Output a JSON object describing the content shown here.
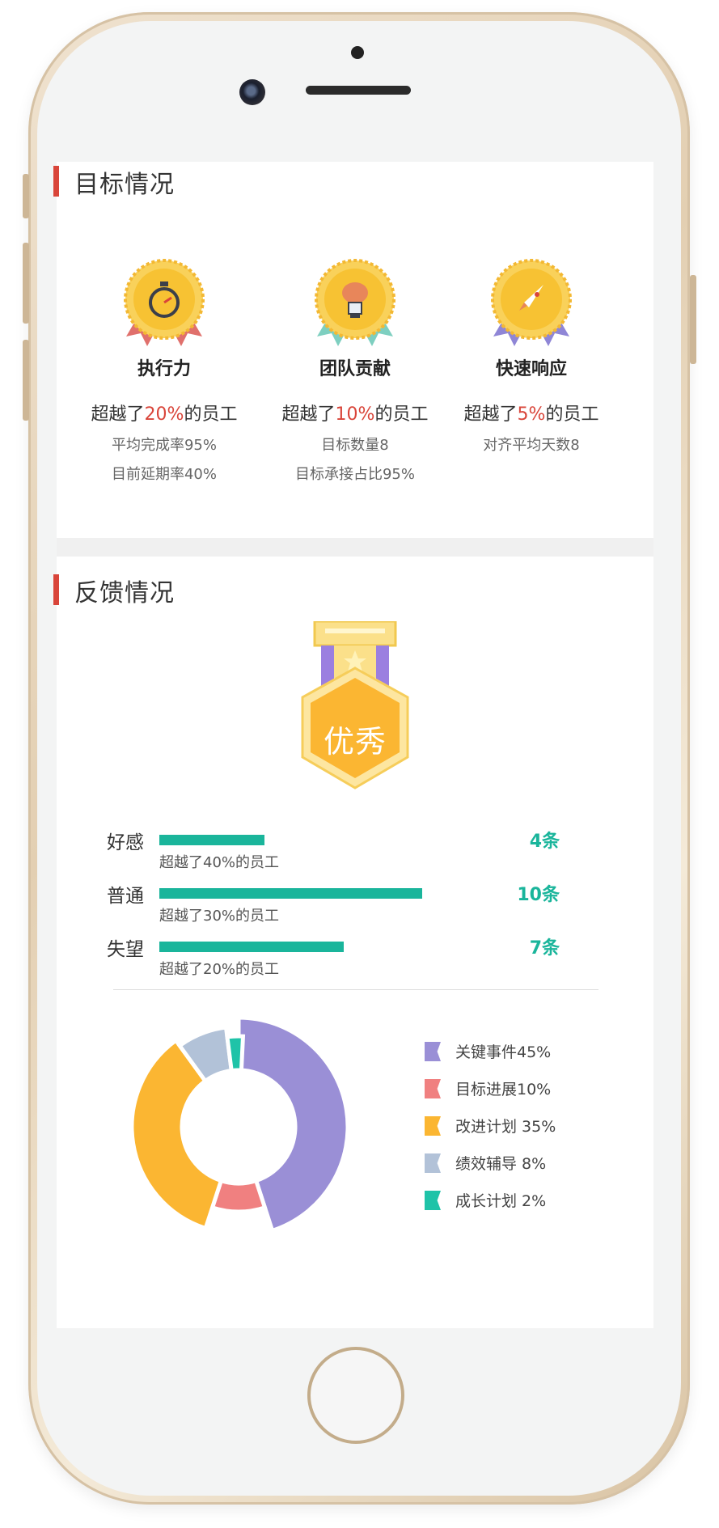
{
  "goals": {
    "title": "目标情况",
    "medals": [
      {
        "name": "执行力",
        "beyond_prefix": "超越了",
        "beyond_pct": "20%",
        "beyond_suffix": "的员工",
        "stats": [
          "平均完成率95%",
          "目前延期率40%"
        ],
        "icon": "timer-icon",
        "ribbon_color": "#e0706c"
      },
      {
        "name": "团队贡献",
        "beyond_prefix": "超越了",
        "beyond_pct": "10%",
        "beyond_suffix": "的员工",
        "stats": [
          "目标数量8",
          "目标承接占比95%"
        ],
        "icon": "brain-lightbulb-icon",
        "ribbon_color": "#7ecfc0"
      },
      {
        "name": "快速响应",
        "beyond_prefix": "超越了",
        "beyond_pct": "5%",
        "beyond_suffix": "的员工",
        "stats": [
          "对齐平均天数8"
        ],
        "icon": "rocket-icon",
        "ribbon_color": "#8f86d6"
      }
    ]
  },
  "feedback": {
    "title": "反馈情况",
    "rating": "优秀",
    "bars": [
      {
        "label": "好感",
        "sub": "超越了40%的员工",
        "count": "4条",
        "value": 4
      },
      {
        "label": "普通",
        "sub": "超越了30%的员工",
        "count": "10条",
        "value": 10
      },
      {
        "label": "失望",
        "sub": "超越了20%的员工",
        "count": "7条",
        "value": 7
      }
    ]
  },
  "chart_data": {
    "type": "pie",
    "categories": [
      "关键事件",
      "目标进展",
      "改进计划",
      "绩效辅导",
      "成长计划"
    ],
    "values": [
      45,
      10,
      35,
      8,
      2
    ],
    "legend_labels": [
      "关键事件45%",
      "目标进展10%",
      "改进计划 35%",
      "绩效辅导 8%",
      "成长计划 2%"
    ],
    "colors": [
      "#9a8fd6",
      "#f08080",
      "#fbb632",
      "#b2c2d8",
      "#1fc3a8"
    ],
    "legend_position": "right"
  },
  "colors": {
    "accent": "#d9453a",
    "teal": "#1ab59b",
    "gold": "#f7c233"
  }
}
